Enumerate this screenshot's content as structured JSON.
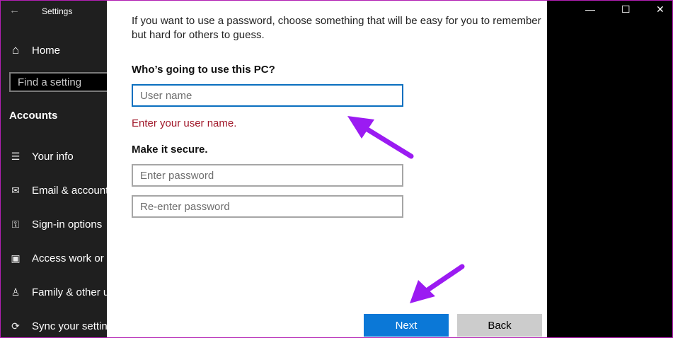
{
  "window": {
    "title": "Settings",
    "back_icon": "←",
    "minimize_icon": "—",
    "maximize_icon": "☐",
    "close_icon": "✕"
  },
  "sidebar": {
    "home_label": "Home",
    "home_icon": "⌂",
    "search_placeholder": "Find a setting",
    "section_label": "Accounts",
    "items": [
      {
        "label": "Your info",
        "icon": "☰"
      },
      {
        "label": "Email & accounts",
        "icon": "✉"
      },
      {
        "label": "Sign-in options",
        "icon": "⚿"
      },
      {
        "label": "Access work or school",
        "icon": "▣"
      },
      {
        "label": "Family & other users",
        "icon": "♙"
      },
      {
        "label": "Sync your settings",
        "icon": "⟳"
      }
    ]
  },
  "dialog": {
    "intro_line1": "If you want to use a password, choose something that will be easy for you to remember",
    "intro_line2": "but hard for others to guess.",
    "question": "Who’s going to use this PC?",
    "username_placeholder": "User name",
    "username_value": "",
    "error_text": "Enter your user name.",
    "secure_heading": "Make it secure.",
    "password_placeholder": "Enter password",
    "reenter_placeholder": "Re-enter password",
    "next_label": "Next",
    "back_label": "Back"
  },
  "colors": {
    "accent": "#0b78d7",
    "error": "#a1182a",
    "annotation_arrow": "#9b1bf2",
    "frame_border": "#b21fb3"
  }
}
